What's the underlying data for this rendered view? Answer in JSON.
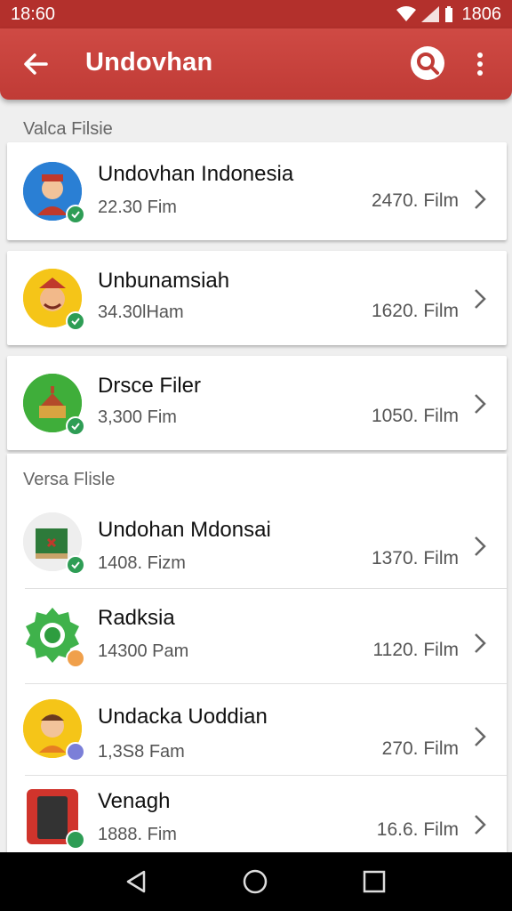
{
  "status_bar": {
    "time": "18:60",
    "battery_text": "1806"
  },
  "app_bar": {
    "title": "Undovhan",
    "back_icon": "arrow-back-icon",
    "search_icon": "search-icon",
    "more_icon": "more-vert-icon"
  },
  "colors": {
    "primary": "#c03b36",
    "status_bar": "#b3302c",
    "badge_green": "#2e9d55"
  },
  "sections": [
    {
      "header": "Valca Filsie"
    },
    {
      "header": "Versa Flisle"
    }
  ],
  "rows": [
    {
      "title": "Undovhan Indonesia",
      "subtitle": "22.30 Fim",
      "count": "2470. Film",
      "icon": "character-avatar-icon"
    },
    {
      "title": "Unbunamsiah",
      "subtitle": "34.30lHam",
      "count": "1620. Film",
      "icon": "character-avatar-icon"
    },
    {
      "title": "Drsce Filer",
      "subtitle": "3,300 Fim",
      "count": "1050. Film",
      "icon": "temple-icon"
    },
    {
      "title": "Undohan Mdonsai",
      "subtitle": "1408. Fizm",
      "count": "1370. Film",
      "icon": "package-icon"
    },
    {
      "title": "Radksia",
      "subtitle": "14300 Pam",
      "count": "1120. Film",
      "icon": "gear-icon"
    },
    {
      "title": "Undacka Uoddian",
      "subtitle": "1,3S8 Fam",
      "count": "270. Film",
      "icon": "character-avatar-icon"
    },
    {
      "title": "Venagh",
      "subtitle": "1888. Fim",
      "count": "16.6. Film",
      "icon": "phone-icon"
    }
  ]
}
